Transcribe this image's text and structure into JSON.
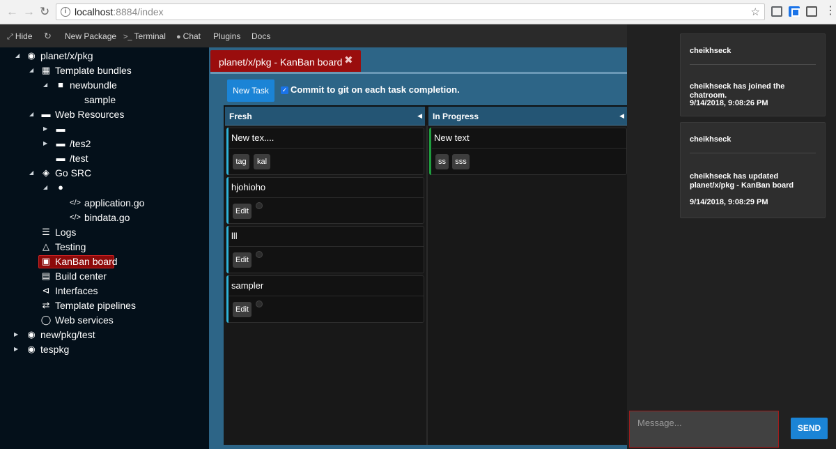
{
  "browser": {
    "url_host": "localhost",
    "url_rest": ":8884/index"
  },
  "toolbar": {
    "items": [
      {
        "icon": "compress-icon",
        "label": "Hide"
      },
      {
        "icon": "refresh-icon",
        "label": ""
      },
      {
        "icon": "",
        "label": "New Package"
      },
      {
        "icon": "terminal-icon",
        "label": "Terminal"
      },
      {
        "icon": "user-icon",
        "label": "Chat"
      },
      {
        "icon": "",
        "label": "Plugins"
      },
      {
        "icon": "",
        "label": "Docs"
      }
    ]
  },
  "sidebar": {
    "items": [
      {
        "label": "planet/x/pkg",
        "icon": "globe-icon",
        "caret": "expanded"
      },
      {
        "label": "Template bundles",
        "icon": "pencil-square-icon",
        "caret": "expanded"
      },
      {
        "label": "newbundle",
        "icon": "square-icon",
        "caret": "expanded"
      },
      {
        "label": "sample",
        "icon": "",
        "caret": "none"
      },
      {
        "label": "Web Resources",
        "icon": "folder-icon",
        "caret": "expanded"
      },
      {
        "label": "",
        "icon": "folder-icon",
        "caret": "collapsed"
      },
      {
        "label": "/tes2",
        "icon": "folder-icon",
        "caret": "collapsed"
      },
      {
        "label": "/test",
        "icon": "folder-icon",
        "caret": "none"
      },
      {
        "label": "Go SRC",
        "icon": "cube-icon",
        "caret": "expanded"
      },
      {
        "label": "",
        "icon": "circle-icon",
        "caret": "expanded"
      },
      {
        "label": "application.go",
        "icon": "code-icon",
        "caret": "none"
      },
      {
        "label": "bindata.go",
        "icon": "code-icon",
        "caret": "none"
      },
      {
        "label": "Logs",
        "icon": "list-icon",
        "caret": "none"
      },
      {
        "label": "Testing",
        "icon": "flask-icon",
        "caret": "none"
      },
      {
        "label": "KanBan board",
        "icon": "briefcase-icon",
        "caret": "none",
        "selected": true
      },
      {
        "label": "Build center",
        "icon": "server-icon",
        "caret": "none"
      },
      {
        "label": "Interfaces",
        "icon": "share-icon",
        "caret": "none"
      },
      {
        "label": "Template pipelines",
        "icon": "exchange-icon",
        "caret": "none"
      },
      {
        "label": "Web services",
        "icon": "circle-notch-icon",
        "caret": "none"
      },
      {
        "label": "new/pkg/test",
        "icon": "globe-icon",
        "caret": "collapsed"
      },
      {
        "label": "tespkg",
        "icon": "globe-icon",
        "caret": "collapsed"
      }
    ]
  },
  "main": {
    "tab_title": "planet/x/pkg - KanBan board",
    "tab_close": "✖",
    "new_task_label": "New Task",
    "commit_label": "Commit to git on each task completion.",
    "commit_checked": true,
    "columns": [
      {
        "name": "Fresh",
        "accent": "#2fb3d9",
        "cards": [
          {
            "title": "New tex....",
            "tags": [
              "tag",
              "kal"
            ],
            "edit": ""
          },
          {
            "title": "hjohioho",
            "tags": [],
            "edit": "Edit"
          },
          {
            "title": "lll",
            "tags": [],
            "edit": "Edit"
          },
          {
            "title": "sampler",
            "tags": [],
            "edit": "Edit"
          }
        ]
      },
      {
        "name": "In Progress",
        "accent": "#1e9e3e",
        "cards": [
          {
            "title": "New text",
            "tags": [
              "ss",
              "sss"
            ],
            "edit": ""
          }
        ]
      }
    ]
  },
  "chat": {
    "messages": [
      {
        "user": "cheikhseck",
        "text": "cheikhseck has joined the chatroom.",
        "time": "9/14/2018, 9:08:26 PM"
      },
      {
        "user": "cheikhseck",
        "text": "cheikhseck has updated planet/x/pkg - KanBan board",
        "time": "9/14/2018, 9:08:29 PM"
      }
    ],
    "input_placeholder": "Message...",
    "send_label": "SEND"
  },
  "colors": {
    "sidebar_bg": "#04101a",
    "main_bg": "#2d6587",
    "tab_active": "#9a0d0d",
    "button_blue": "#1b84d6",
    "chat_bg": "#212121"
  }
}
